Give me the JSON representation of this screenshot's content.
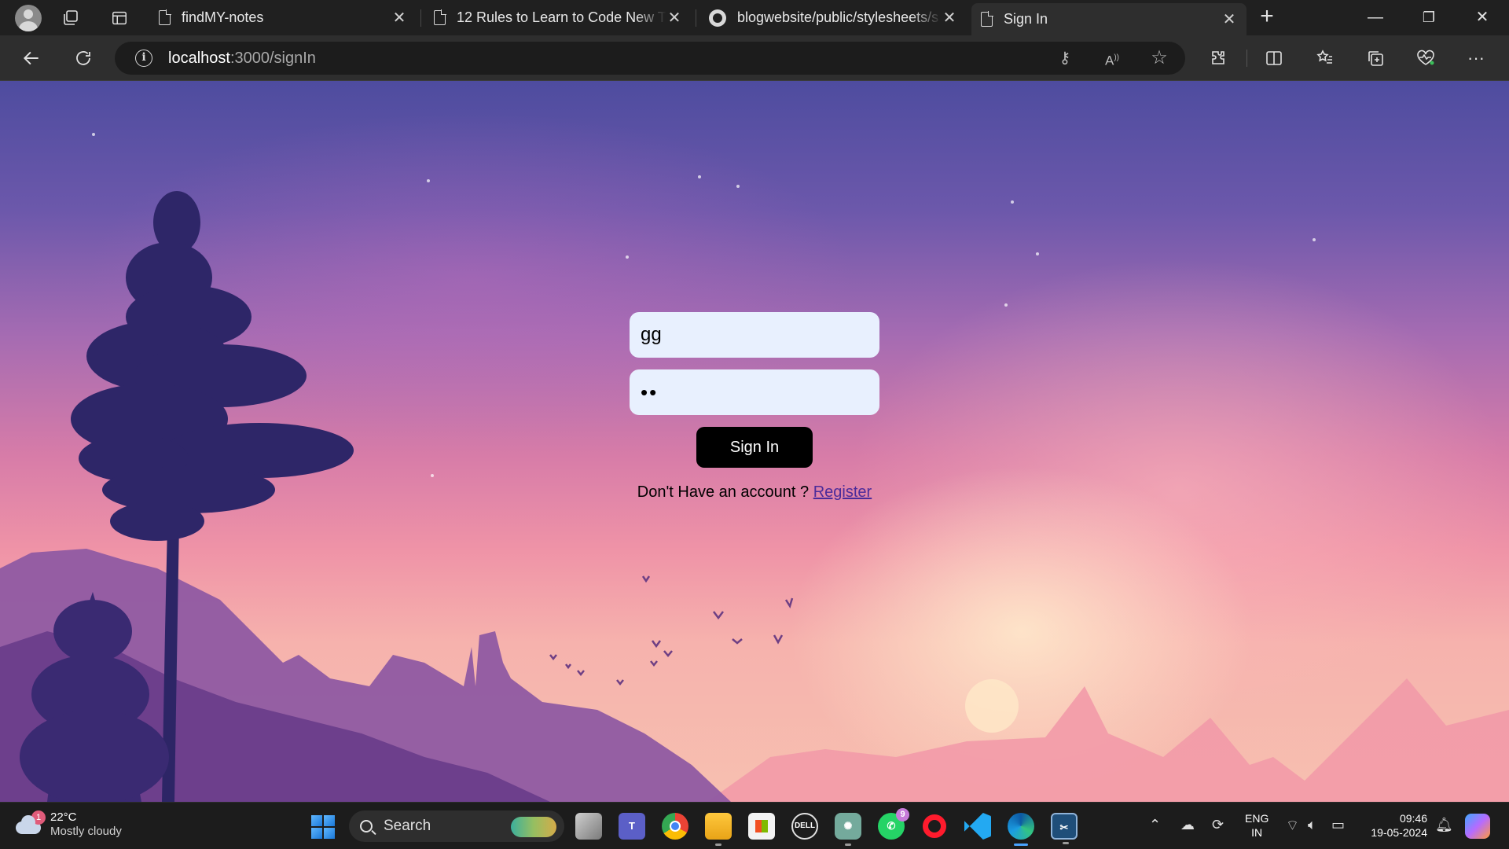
{
  "browser": {
    "tabs": [
      {
        "title": "findMY-notes",
        "icon": "page-icon",
        "active": false
      },
      {
        "title": "12 Rules to Learn to Code New T",
        "icon": "page-icon",
        "active": false
      },
      {
        "title": "blogwebsite/public/stylesheets/s",
        "icon": "github-icon",
        "active": false
      },
      {
        "title": "Sign In",
        "icon": "page-icon",
        "active": true
      }
    ],
    "new_tab_symbol": "+",
    "window_controls": {
      "minimize": "—",
      "restore": "❐",
      "close": "✕"
    },
    "address": {
      "host": "localhost",
      "path": ":3000/signIn"
    }
  },
  "signin_form": {
    "username_value": "gg",
    "password_masked": "••",
    "submit_label": "Sign In",
    "register_prompt": "Don't Have an account ?",
    "register_link": "Register"
  },
  "taskbar": {
    "weather": {
      "temp": "22°C",
      "condition": "Mostly cloudy",
      "badge": "1"
    },
    "search_placeholder": "Search",
    "apps": [
      "task-view",
      "teams",
      "chrome",
      "file-explorer",
      "microsoft-store",
      "dell",
      "chatgpt",
      "whatsapp",
      "opera",
      "vscode",
      "edge",
      "snipping-tool"
    ],
    "whatsapp_badge": "9",
    "language": {
      "line1": "ENG",
      "line2": "IN"
    },
    "clock": {
      "time": "09:46",
      "date": "19-05-2024"
    }
  },
  "colors": {
    "input_bg": "#e8f0fe",
    "button_bg": "#000000",
    "link_color": "#4b2b9a"
  }
}
